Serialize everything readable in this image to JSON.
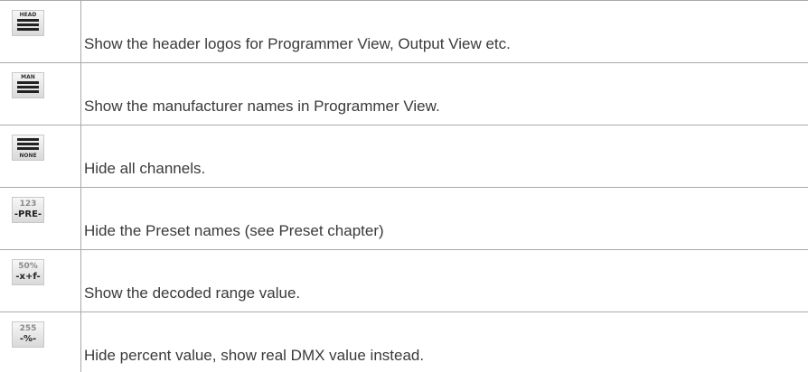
{
  "rows": [
    {
      "icon": "head-lines-icon",
      "icon_label": "HEAD",
      "text": "Show the header logos for Programmer View, Output View etc."
    },
    {
      "icon": "man-lines-icon",
      "icon_label": "MAN",
      "text": "Show the manufacturer names in Programmer View."
    },
    {
      "icon": "none-lines-icon",
      "icon_label": "NONE",
      "text": "Hide all channels."
    },
    {
      "icon": "preset-icon",
      "icon_top": "123",
      "icon_bottom": "-PRE-",
      "text": "Hide the Preset names (see Preset chapter)"
    },
    {
      "icon": "decoded-range-icon",
      "icon_top": "50%",
      "icon_bottom": "-x+f-",
      "text": "Show the decoded range value."
    },
    {
      "icon": "dmx-value-icon",
      "icon_top": "255",
      "icon_bottom": "-%-",
      "text": "Hide percent value, show real DMX value instead."
    }
  ]
}
